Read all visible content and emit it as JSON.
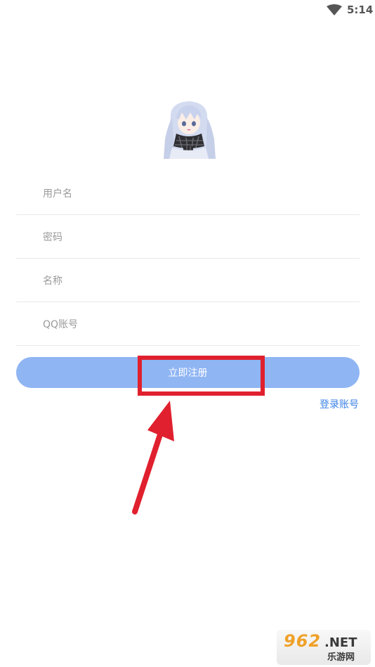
{
  "status_bar": {
    "time": "5:14",
    "wifi_icon": "wifi-icon"
  },
  "avatar": {
    "icon": "anime-girl-avatar"
  },
  "form": {
    "username_placeholder": "用户名",
    "password_placeholder": "密码",
    "nickname_placeholder": "名称",
    "qq_placeholder": "QQ账号"
  },
  "register_button_label": "立即注册",
  "login_link_label": "登录账号",
  "watermark": {
    "number": "962",
    "net": ".NET",
    "cn": "乐游网"
  },
  "colors": {
    "button": "#8fb5f3",
    "link": "#3b82e6",
    "highlight": "#e0202e",
    "divider": "#e8e8e8"
  }
}
